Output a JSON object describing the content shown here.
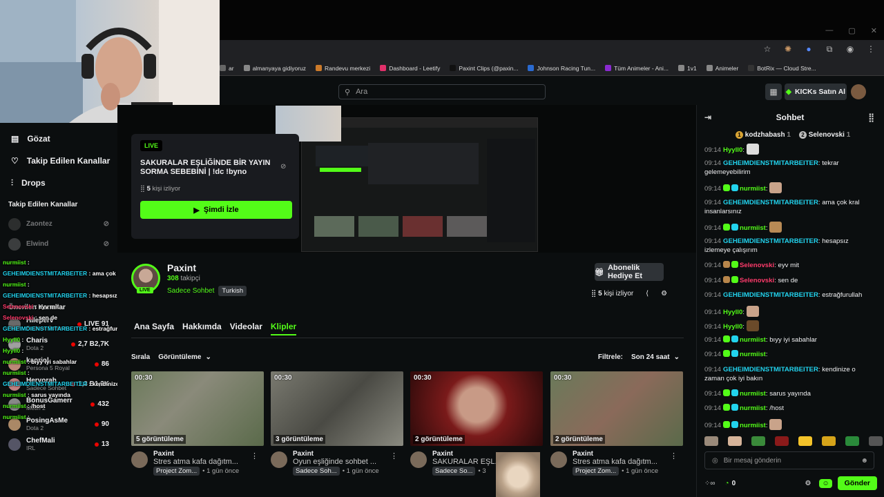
{
  "browser": {
    "bookmarks": [
      {
        "label": "ar",
        "color": "#666"
      },
      {
        "label": "almanyaya gidiyoruz",
        "color": "#888"
      },
      {
        "label": "Randevu merkezi",
        "color": "#cc7a2a"
      },
      {
        "label": "Dashboard - Leetify",
        "color": "#e0306a"
      },
      {
        "label": "Paxint Clips (@paxin...",
        "color": "#111"
      },
      {
        "label": "Johnson Racing Tun...",
        "color": "#2a6ad0"
      },
      {
        "label": "Tüm Animeler - Ani...",
        "color": "#8a2ad0"
      },
      {
        "label": "1v1",
        "color": "#888"
      },
      {
        "label": "Animeler",
        "color": "#888"
      },
      {
        "label": "BotRix — Cloud Stre...",
        "color": "#333"
      }
    ]
  },
  "header": {
    "search_placeholder": "Ara",
    "kicks_label": "KICKs Satın Al"
  },
  "sidebar": {
    "nav": [
      {
        "label": "Gözat",
        "icon": "browse-icon"
      },
      {
        "label": "Takip Edilen Kanallar",
        "icon": "heart-icon"
      },
      {
        "label": "Drops",
        "icon": "drops-icon"
      }
    ],
    "followed_title": "Takip Edilen Kanallar",
    "followed": [
      {
        "name": "Zaontez"
      },
      {
        "name": "Elwind"
      }
    ],
    "recommended_title": "Önerilen Kanallar",
    "recommended": [
      {
        "name": "Hileperv",
        "sub": "Sadece Sohbet",
        "viewers": "LIVE 91"
      },
      {
        "name": "Charis",
        "sub": "Dota 2",
        "viewers": "2,7 B2,7K"
      },
      {
        "name": "kaoriol",
        "sub": "Persona 5 Royal",
        "viewers": "86"
      },
      {
        "name": "Hervorah",
        "sub": "Sadece Sohbet",
        "viewers": "1,3 B1,3K"
      },
      {
        "name": "BonusGamerr",
        "sub": "Metin 2",
        "viewers": "432"
      },
      {
        "name": "PosingAsMe",
        "sub": "Dota 2",
        "viewers": "90"
      },
      {
        "name": "ChefMali",
        "sub": "IRL",
        "viewers": "13"
      }
    ]
  },
  "overlay_chat": [
    {
      "user": "nurmiist",
      "text": ":",
      "color": "#53fc18"
    },
    {
      "user": "GEHEIMDIENSTMITARBEITER",
      "text": ": ama çok kral insanlarsınız",
      "color": "#22d3ee"
    },
    {
      "user": "nurmiist",
      "text": ":",
      "color": "#53fc18"
    },
    {
      "user": "GEHEIMDIENSTMITARBEITER",
      "text": ": hesapsız izlemeye çalışırım",
      "color": "#22d3ee"
    },
    {
      "user": "Selenovski",
      "text": ": eyv mit",
      "color": "#ff3b6b"
    },
    {
      "user": "Selenovski",
      "text": ": sen de",
      "color": "#ff3b6b"
    },
    {
      "user": "GEHEIMDIENSTMITARBEITER",
      "text": ": estrağfurullah",
      "color": "#22d3ee"
    },
    {
      "user": "Hyyll0",
      "text": ":",
      "color": "#53fc18"
    },
    {
      "user": "Hyyll0",
      "text": ":",
      "color": "#53fc18"
    },
    {
      "user": "nurmiist",
      "text": ": bıyy iyi sabahlar",
      "color": "#53fc18"
    },
    {
      "user": "nurmiist",
      "text": ":",
      "color": "#53fc18"
    },
    {
      "user": "GEHEIMDIENSTMITARBEITER",
      "text": ": kendinize o zaman çok iyi bakın",
      "color": "#22d3ee"
    },
    {
      "user": "nurmiist",
      "text": ": sarus yayında",
      "color": "#53fc18"
    },
    {
      "user": "nurmiist",
      "text": ": /host",
      "color": "#53fc18"
    },
    {
      "user": "nurmiist",
      "text": ":",
      "color": "#53fc18"
    }
  ],
  "offline_card": {
    "live": "LIVE",
    "title": "SAKURALAR EŞLİĞİNDE BİR YAYIN SORMA SEBEBİNİ | !dc !byno",
    "viewers_count": "5",
    "viewers_suffix": "kişi izliyor",
    "watch_label": "Şimdi İzle"
  },
  "channel": {
    "name": "Paxint",
    "followers_count": "308",
    "followers_suffix": "takipçi",
    "category": "Sadece Sohbet",
    "language": "Turkish",
    "live_badge": "LIVE",
    "subscribe_label": "Abonelik Hediye Et",
    "viewers_count": "5",
    "viewers_suffix": "kişi izliyor"
  },
  "tabs": [
    "Ana Sayfa",
    "Hakkımda",
    "Videolar",
    "Klipler"
  ],
  "sort": {
    "sort_label": "Sırala",
    "sort_value": "Görüntüleme",
    "filter_label": "Filtrele:",
    "filter_value": "Son 24 saat"
  },
  "clips": [
    {
      "duration": "00:30",
      "views": "5 görüntüleme",
      "channel": "Paxint",
      "title": "Stres atma kafa dağıtm...",
      "tag": "Project Zom...",
      "age": "• 1 gün önce"
    },
    {
      "duration": "00:30",
      "views": "3 görüntüleme",
      "channel": "Paxint",
      "title": "Oyun eşliğinde sohbet ...",
      "tag": "Sadece Soh...",
      "age": "• 1 gün önce"
    },
    {
      "duration": "00:30",
      "views": "2 görüntüleme",
      "channel": "Paxint",
      "title": "SAKURALAR EŞL...",
      "tag": "Sadece So...",
      "age": "• 3"
    },
    {
      "duration": "00:30",
      "views": "2 görüntüleme",
      "channel": "Paxint",
      "title": "Stres atma kafa dağıtm...",
      "tag": "Project Zom...",
      "age": "• 1 gün önce"
    }
  ],
  "chat": {
    "title": "Sohbet",
    "pinned": [
      {
        "rank": "1",
        "user": "kodzhabash",
        "n": "1"
      },
      {
        "rank": "2",
        "user": "Selenovski",
        "n": "1"
      }
    ],
    "messages": [
      {
        "time": "09:14",
        "user": "Hyyll0",
        "color": "#53fc18",
        "text": ":",
        "emote": "#ddd",
        "badges": []
      },
      {
        "time": "09:14",
        "user": "GEHEIMDIENSTMITARBEITER",
        "color": "#22d3ee",
        "text": ": tekrar gelemeyebilirim",
        "badges": []
      },
      {
        "time": "09:14",
        "user": "nurmiist",
        "color": "#53fc18",
        "text": ":",
        "emote": "#c9a38a",
        "badges": [
          "#53fc18",
          "#22d3ee"
        ]
      },
      {
        "time": "09:14",
        "user": "GEHEIMDIENSTMITARBEITER",
        "color": "#22d3ee",
        "text": ": ama çok kral insanlarsınız",
        "badges": []
      },
      {
        "time": "09:14",
        "user": "nurmiist",
        "color": "#53fc18",
        "text": ":",
        "emote": "#b88a55",
        "badges": [
          "#53fc18",
          "#22d3ee"
        ]
      },
      {
        "time": "09:14",
        "user": "GEHEIMDIENSTMITARBEITER",
        "color": "#22d3ee",
        "text": ": hesapsız izlemeye çalışırım",
        "badges": []
      },
      {
        "time": "09:14",
        "user": "Selenovski",
        "color": "#ff3b6b",
        "text": ": eyv mit",
        "badges": [
          "#b8864b",
          "#53fc18"
        ]
      },
      {
        "time": "09:14",
        "user": "Selenovski",
        "color": "#ff3b6b",
        "text": ": sen de",
        "badges": [
          "#b8864b",
          "#53fc18"
        ]
      },
      {
        "time": "09:14",
        "user": "GEHEIMDIENSTMITARBEITER",
        "color": "#22d3ee",
        "text": ": estrağfurullah",
        "badges": []
      },
      {
        "time": "09:14",
        "user": "Hyyll0",
        "color": "#53fc18",
        "text": ":",
        "emote": "#c9a38a",
        "badges": []
      },
      {
        "time": "09:14",
        "user": "Hyyll0",
        "color": "#53fc18",
        "text": ":",
        "emote": "#6a4a2a",
        "badges": []
      },
      {
        "time": "09:14",
        "user": "nurmiist",
        "color": "#53fc18",
        "text": ": bıyy iyi sabahlar",
        "badges": [
          "#53fc18",
          "#22d3ee"
        ]
      },
      {
        "time": "09:14",
        "user": "nurmiist",
        "color": "#53fc18",
        "text": ":",
        "badges": [
          "#53fc18",
          "#22d3ee"
        ]
      },
      {
        "time": "09:14",
        "user": "GEHEIMDIENSTMITARBEITER",
        "color": "#22d3ee",
        "text": ": kendinize o zaman çok iyi bakın",
        "badges": []
      },
      {
        "time": "09:14",
        "user": "nurmiist",
        "color": "#53fc18",
        "text": ": sarus yayında",
        "badges": [
          "#53fc18",
          "#22d3ee"
        ]
      },
      {
        "time": "09:14",
        "user": "nurmiist",
        "color": "#53fc18",
        "text": ": /host",
        "badges": [
          "#53fc18",
          "#22d3ee"
        ]
      },
      {
        "time": "09:14",
        "user": "nurmiist",
        "color": "#53fc18",
        "text": ":",
        "emote": "#c9a38a",
        "badges": [
          "#53fc18",
          "#22d3ee"
        ]
      }
    ],
    "input_placeholder": "Bir mesaj gönderin",
    "points": "0",
    "send_label": "Gönder"
  },
  "colors": {
    "accent": "#53fc18",
    "background": "#0b0e0f"
  }
}
